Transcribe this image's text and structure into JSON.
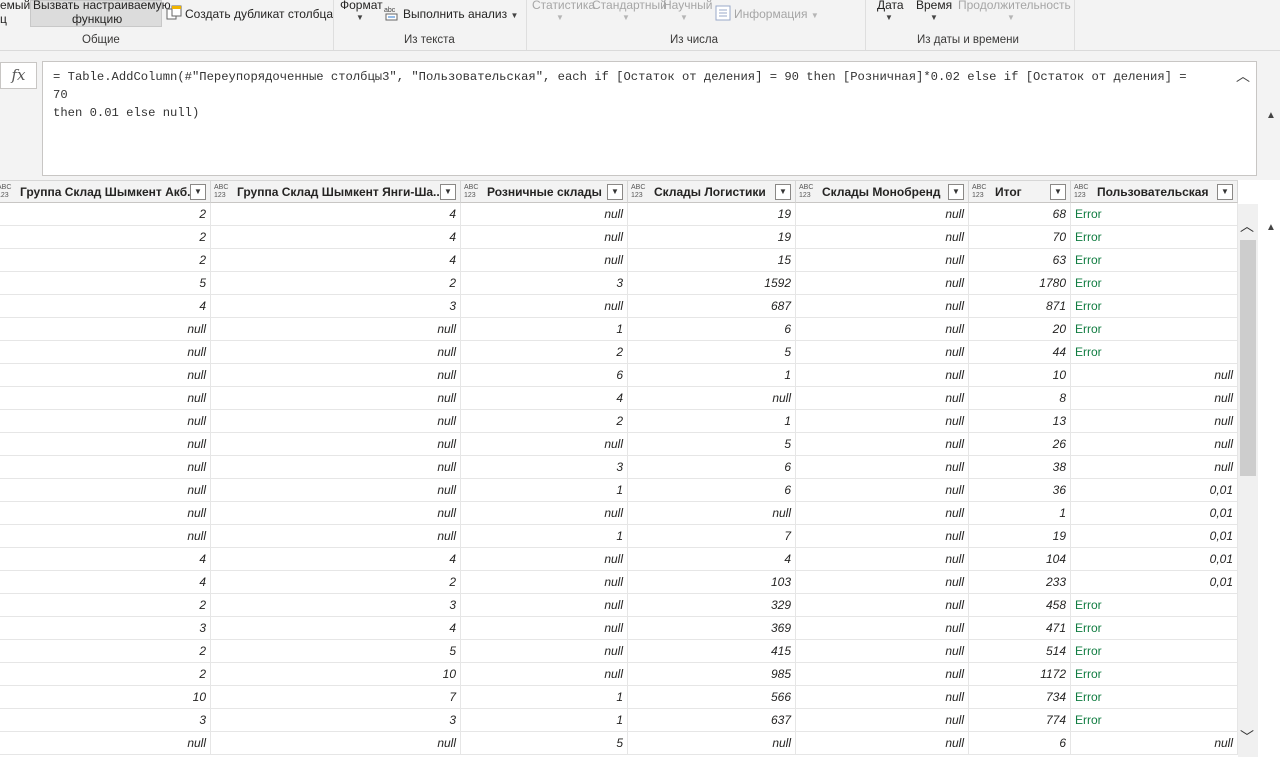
{
  "ribbon": {
    "partial_left_top": "емый",
    "partial_left_bottom": "ц",
    "invoke_fn_line1": "Вызвать настраиваемую",
    "invoke_fn_line2": "функцию",
    "duplicate_col": "Создать дубликат столбца",
    "format": "Формат",
    "analyze": "Выполнить анализ",
    "statistics": "Статистика",
    "standard": "Стандартный",
    "scientific": "Научный",
    "info": "Информация",
    "date": "Дата",
    "time": "Время",
    "duration": "Продолжительность",
    "groups": {
      "general": "Общие",
      "from_text": "Из текста",
      "from_number": "Из числа",
      "from_datetime": "Из даты и времени"
    }
  },
  "formula_bar": {
    "fx": "fx",
    "text": "= Table.AddColumn(#\"Переупорядоченные столбцы3\", \"Пользовательская\", each if [Остаток от деления] = 90 then [Розничная]*0.02 else if [Остаток от деления] = 70\nthen 0.01 else null)"
  },
  "table": {
    "type_icon": "ABC\n123",
    "columns": [
      "Группа Склад Шымкент Акб...",
      "Группа Склад Шымкент Янги-Ша...",
      "Розничные склады",
      "Склады Логистики",
      "Склады Монобренд",
      "Итог",
      "Пользовательская"
    ],
    "rows": [
      [
        "2",
        "4",
        "null",
        "19",
        "null",
        "68",
        "Error"
      ],
      [
        "2",
        "4",
        "null",
        "19",
        "null",
        "70",
        "Error"
      ],
      [
        "2",
        "4",
        "null",
        "15",
        "null",
        "63",
        "Error"
      ],
      [
        "5",
        "2",
        "3",
        "1592",
        "null",
        "1780",
        "Error"
      ],
      [
        "4",
        "3",
        "null",
        "687",
        "null",
        "871",
        "Error"
      ],
      [
        "null",
        "null",
        "1",
        "6",
        "null",
        "20",
        "Error"
      ],
      [
        "null",
        "null",
        "2",
        "5",
        "null",
        "44",
        "Error"
      ],
      [
        "null",
        "null",
        "6",
        "1",
        "null",
        "10",
        "null"
      ],
      [
        "null",
        "null",
        "4",
        "null",
        "null",
        "8",
        "null"
      ],
      [
        "null",
        "null",
        "2",
        "1",
        "null",
        "13",
        "null"
      ],
      [
        "null",
        "null",
        "null",
        "5",
        "null",
        "26",
        "null"
      ],
      [
        "null",
        "null",
        "3",
        "6",
        "null",
        "38",
        "null"
      ],
      [
        "null",
        "null",
        "1",
        "6",
        "null",
        "36",
        "0,01"
      ],
      [
        "null",
        "null",
        "null",
        "null",
        "null",
        "1",
        "0,01"
      ],
      [
        "null",
        "null",
        "1",
        "7",
        "null",
        "19",
        "0,01"
      ],
      [
        "4",
        "4",
        "null",
        "4",
        "null",
        "104",
        "0,01"
      ],
      [
        "4",
        "2",
        "null",
        "103",
        "null",
        "233",
        "0,01"
      ],
      [
        "2",
        "3",
        "null",
        "329",
        "null",
        "458",
        "Error"
      ],
      [
        "3",
        "4",
        "null",
        "369",
        "null",
        "471",
        "Error"
      ],
      [
        "2",
        "5",
        "null",
        "415",
        "null",
        "514",
        "Error"
      ],
      [
        "2",
        "10",
        "null",
        "985",
        "null",
        "1172",
        "Error"
      ],
      [
        "10",
        "7",
        "1",
        "566",
        "null",
        "734",
        "Error"
      ],
      [
        "3",
        "3",
        "1",
        "637",
        "null",
        "774",
        "Error"
      ],
      [
        "null",
        "null",
        "5",
        "null",
        "null",
        "6",
        "null"
      ]
    ]
  },
  "colors": {
    "error": "#107c41",
    "ribbon_bg": "#f3f3f3"
  }
}
